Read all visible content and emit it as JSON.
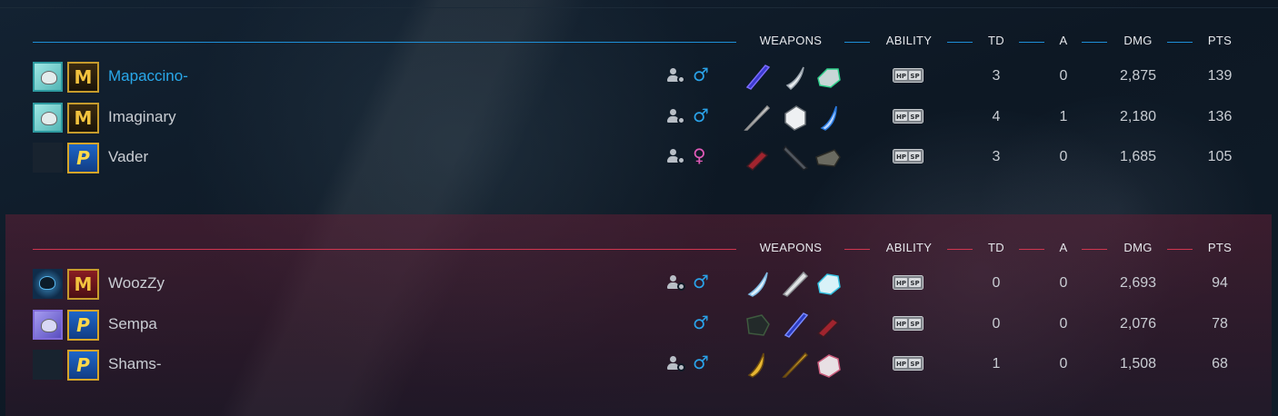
{
  "columns": {
    "weapons": "WEAPONS",
    "ability": "ABILITY",
    "td": "TD",
    "a": "A",
    "dmg": "DMG",
    "pts": "PTS"
  },
  "colors": {
    "blue_team": "#1d8fd8",
    "red_team": "#d0364f",
    "highlight_name": "#29a8ea"
  },
  "teams": [
    {
      "side": "blue",
      "players": [
        {
          "name": "Mapaccino-",
          "avatar": "light-avatar",
          "rank": "master-rank",
          "friend_icon": true,
          "gender": "♂",
          "weapons": [
            "purple-blade-icon",
            "white-claw-icon",
            "green-gauntlet-icon"
          ],
          "td": "3",
          "a": "0",
          "dmg": "2,875",
          "pts": "139",
          "highlight": true
        },
        {
          "name": "Imaginary",
          "avatar": "light-avatar",
          "rank": "master-rank",
          "friend_icon": true,
          "gender": "♂",
          "weapons": [
            "silver-sword-icon",
            "white-gauntlet-icon",
            "blue-claw-icon"
          ],
          "td": "4",
          "a": "1",
          "dmg": "2,180",
          "pts": "136",
          "highlight": false
        },
        {
          "name": "Vader",
          "avatar": "empty-avatar",
          "rank": "platinum-rank",
          "friend_icon": true,
          "gender": "♀",
          "weapons": [
            "red-dagger-icon",
            "dark-twinblade-icon",
            "dark-cannon-icon"
          ],
          "td": "3",
          "a": "0",
          "dmg": "1,685",
          "pts": "105",
          "highlight": false
        }
      ]
    },
    {
      "side": "red",
      "players": [
        {
          "name": "WoozZy",
          "avatar": "dragon-avatar",
          "rank": "master-rank",
          "friend_icon": true,
          "gender": "♂",
          "weapons": [
            "ice-claw-icon",
            "silver-staff-icon",
            "cyan-gauntlet-icon"
          ],
          "td": "0",
          "a": "0",
          "dmg": "2,693",
          "pts": "94",
          "highlight": false
        },
        {
          "name": "Sempa",
          "avatar": "purple-avatar",
          "rank": "platinum-rank",
          "friend_icon": false,
          "gender": "♂",
          "weapons": [
            "dark-glove-icon",
            "blue-blade-icon",
            "red-dagger-icon"
          ],
          "td": "0",
          "a": "0",
          "dmg": "2,076",
          "pts": "78",
          "highlight": false
        },
        {
          "name": "Shams-",
          "avatar": "empty-avatar",
          "rank": "platinum-rank",
          "friend_icon": true,
          "gender": "♂",
          "weapons": [
            "gold-claw-icon",
            "gold-sword-icon",
            "pink-gauntlet-icon"
          ],
          "td": "1",
          "a": "0",
          "dmg": "1,508",
          "pts": "68",
          "highlight": false
        }
      ]
    }
  ],
  "ability_icon": "hp-sp-icon"
}
